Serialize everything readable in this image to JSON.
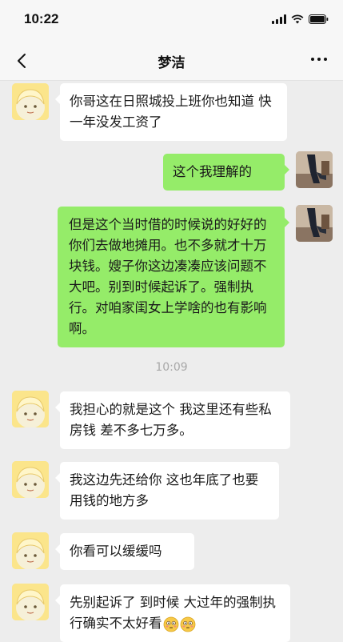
{
  "status": {
    "time": "10:22"
  },
  "header": {
    "title": "梦洁"
  },
  "messages": [
    {
      "side": "left",
      "text": "你哥这在日照城投上班你也知道 快一年没发工资了"
    },
    {
      "side": "right",
      "text": "这个我理解的"
    },
    {
      "side": "right",
      "text": "但是这个当时借的时候说的好好的你们去做地摊用。也不多就才十万块钱。嫂子你这边凑凑应该问题不大吧。别到时候起诉了。强制执行。对咱家闺女上学啥的也有影响啊。"
    },
    {
      "side": "time",
      "text": "10:09"
    },
    {
      "side": "left",
      "text": "我担心的就是这个 我这里还有些私房钱 差不多七万多。"
    },
    {
      "side": "left",
      "text": "我这边先还给你 这也年底了也要用钱的地方多"
    },
    {
      "side": "left",
      "text": "你看可以缓缓吗"
    },
    {
      "side": "left",
      "text": "先别起诉了 到时候 大过年的强制执行确实不太好看",
      "emoji": [
        "flushed-face-icon",
        "flushed-face-icon"
      ]
    }
  ],
  "colors": {
    "sent_bubble": "#95ec69",
    "received_bubble": "#ffffff",
    "background": "#ededed"
  }
}
